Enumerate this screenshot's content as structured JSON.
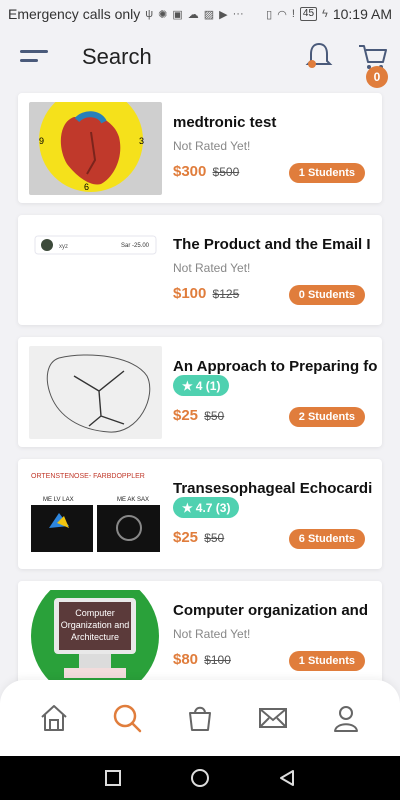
{
  "status_bar": {
    "left_text": "Emergency calls only",
    "battery": "45",
    "time": "10:19 AM"
  },
  "header": {
    "title": "Search",
    "cart_count": "0"
  },
  "courses": [
    {
      "title": "medtronic test",
      "rating_text": "Not Rated Yet!",
      "price": "$300",
      "old_price": "$500",
      "students": "1 Students"
    },
    {
      "title": "The Product and the Email I",
      "rating_text": "Not Rated Yet!",
      "price": "$100",
      "old_price": "$125",
      "students": "0 Students",
      "thumb": {
        "name": "xyz",
        "right": "Sar -25.00"
      }
    },
    {
      "title": "An Approach to Preparing fo",
      "rating": "4 (1)",
      "price": "$25",
      "old_price": "$50",
      "students": "2 Students"
    },
    {
      "title": "Transesophageal Echocardi",
      "rating": "4.7 (3)",
      "price": "$25",
      "old_price": "$50",
      "students": "6 Students",
      "thumb": {
        "header": "ORTENSTENOSE- FARBDOPPLER",
        "left": "ME LV LAX",
        "right": "ME AK SAX"
      }
    },
    {
      "title": "Computer organization and",
      "rating_text": "Not Rated Yet!",
      "price": "$80",
      "old_price": "$100",
      "students": "1 Students",
      "thumb": {
        "sign": "Computer Organization and Architecture"
      }
    }
  ],
  "colors": {
    "accent": "#e07d3c",
    "rating": "#4fd1b0",
    "nav_icon": "#666",
    "active_nav": "#e07d3c"
  }
}
